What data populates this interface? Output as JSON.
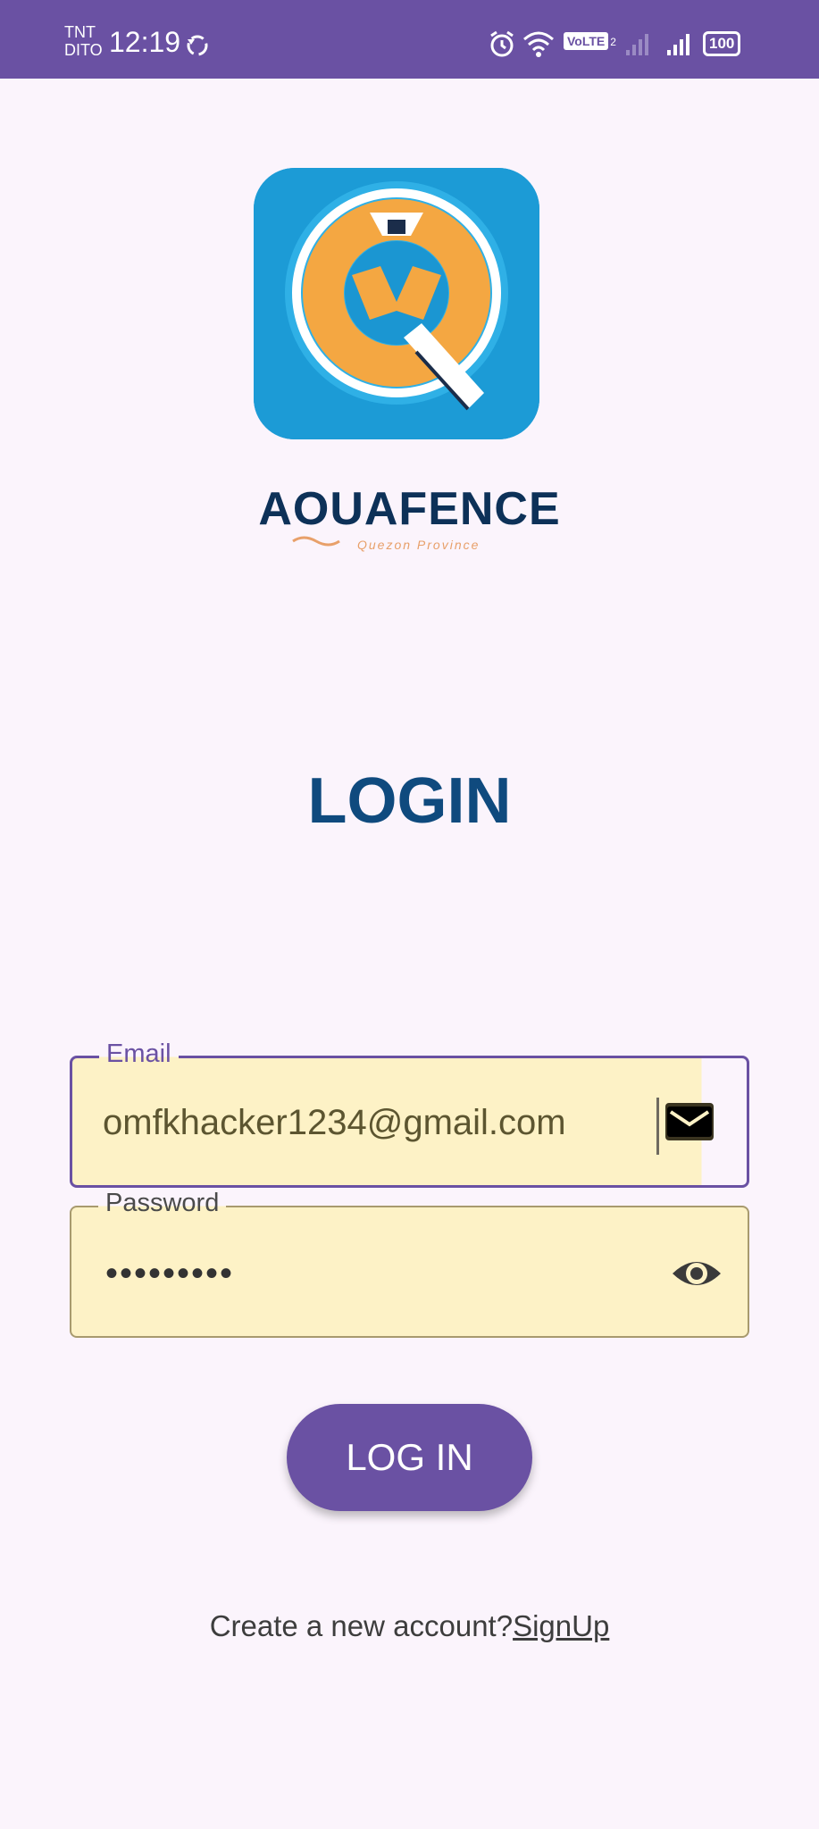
{
  "status_bar": {
    "carrier_line1": "TNT",
    "carrier_line2": "DITO",
    "time": "12:19",
    "volte": "VoLTE",
    "sim_slot": "2",
    "battery": "100"
  },
  "brand": {
    "name": "AOUAFENCE",
    "subtitle": "Quezon Province"
  },
  "login": {
    "title": "LOGIN",
    "email_label": "Email",
    "email_value": "omfkhacker1234@gmail.com",
    "password_label": "Password",
    "password_value": "•••••••••",
    "button_label": "LOG IN",
    "signup_prompt": "Create a new account?",
    "signup_link": "SignUp"
  },
  "colors": {
    "accent": "#6a51a3",
    "title": "#0f4a7e",
    "field_fill": "#fdf2c6",
    "background": "#fbf4fc"
  },
  "icons": [
    "sync-icon",
    "alarm-icon",
    "wifi-icon",
    "signal-icon",
    "battery-icon",
    "mail-icon",
    "eye-icon"
  ]
}
